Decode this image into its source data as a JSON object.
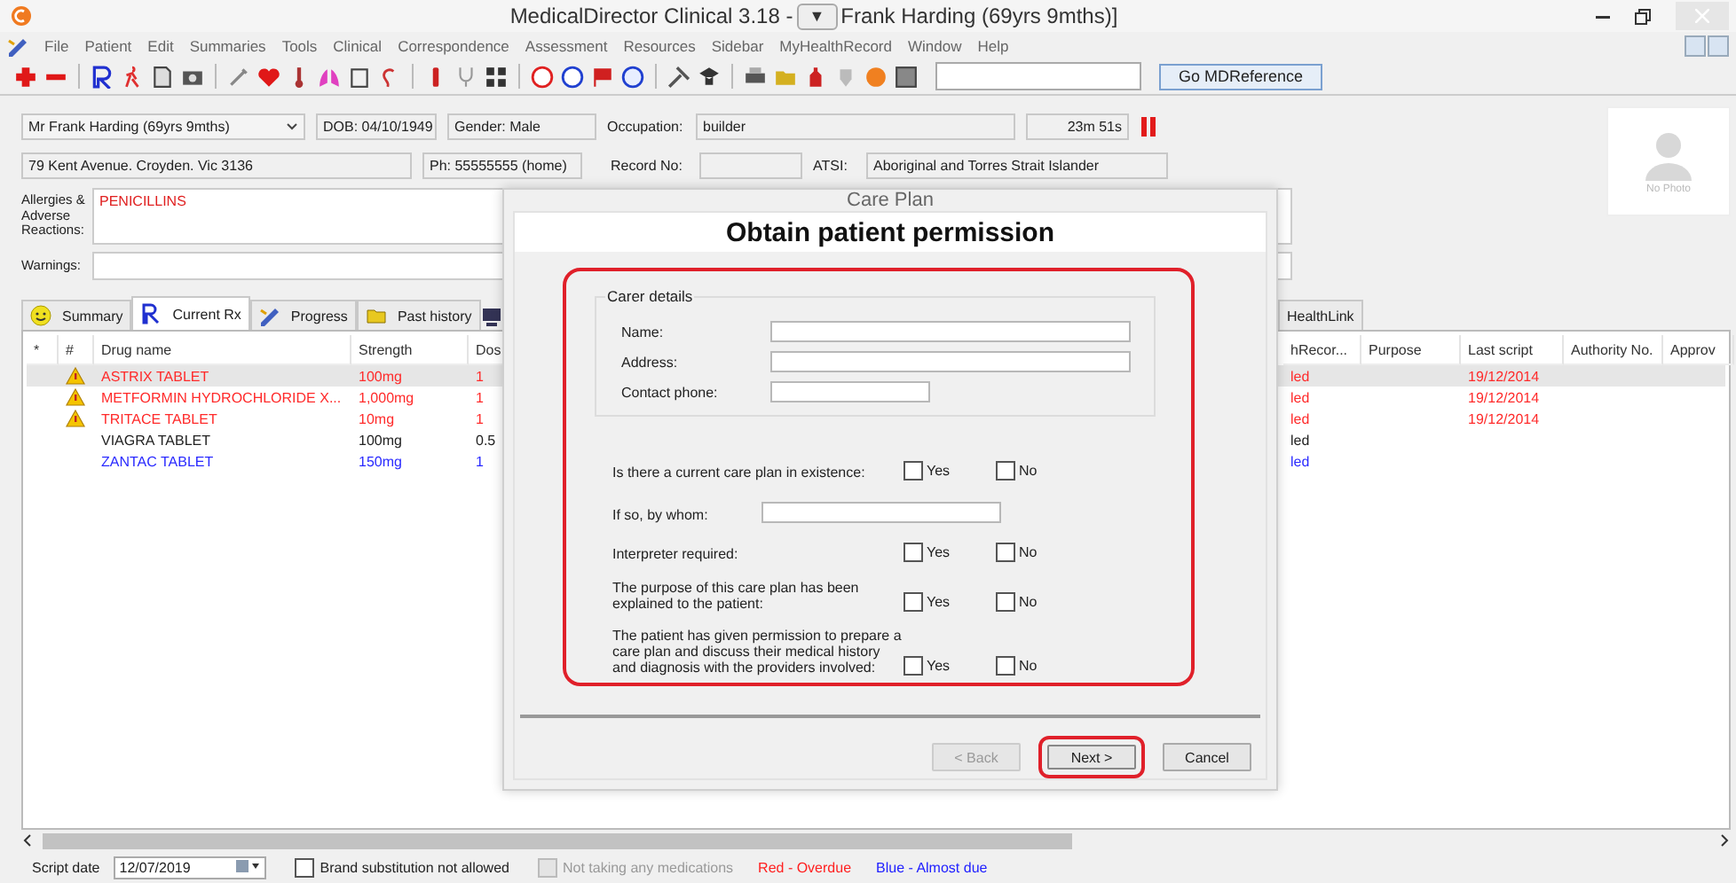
{
  "window": {
    "title_app": "MedicalDirector Clinical 3.18 -",
    "title_button": "▼",
    "title_patient": "Frank Harding (69yrs 9mths)]"
  },
  "menu": [
    "File",
    "Patient",
    "Edit",
    "Summaries",
    "Tools",
    "Clinical",
    "Correspondence",
    "Assessment",
    "Resources",
    "Sidebar",
    "MyHealthRecord",
    "Window",
    "Help"
  ],
  "toolbar": {
    "search_button": "Go MDReference"
  },
  "patient": {
    "name": "Mr Frank Harding (69yrs 9mths)",
    "dob": "DOB: 04/10/1949",
    "gender": "Gender: Male",
    "occupation_label": "Occupation:",
    "occupation": "builder",
    "timer": "23m 51s",
    "timer_paused": false,
    "address": "79 Kent Avenue. Croyden. Vic  3136",
    "phone": "Ph: 55555555 (home)",
    "record_label": "Record No:",
    "atsi_label": "ATSI:",
    "atsi": "Aboriginal and Torres Strait Islander",
    "photo": "No Photo",
    "allergies_label": "Allergies & Adverse Reactions:",
    "allergies": "PENICILLINS",
    "warnings_label": "Warnings:"
  },
  "tabs": [
    {
      "label": "Summary",
      "selected": false
    },
    {
      "label": "Current Rx",
      "selected": true
    },
    {
      "label": "Progress",
      "selected": false
    },
    {
      "label": "Past history",
      "selected": false
    },
    {
      "label": "HealthLink",
      "selected": false
    }
  ],
  "table": {
    "columns": [
      "*",
      "#",
      "Drug name",
      "Strength",
      "Dos",
      "hRecor...",
      "Purpose",
      "Last script",
      "Authority No.",
      "Approv"
    ],
    "rows": [
      {
        "warning": true,
        "color": "#ff2a2a",
        "selected": true,
        "drug": "ASTRIX TABLET",
        "strength": "100mg",
        "dose": "1",
        "column_6": "led",
        "last_script": "19/12/2014"
      },
      {
        "warning": true,
        "color": "#ff2a2a",
        "selected": false,
        "drug": "METFORMIN HYDROCHLORIDE X...",
        "strength": "1,000mg",
        "dose": "1",
        "column_6": "led",
        "last_script": "19/12/2014"
      },
      {
        "warning": true,
        "color": "#ff2a2a",
        "selected": false,
        "drug": "TRITACE TABLET",
        "strength": "10mg",
        "dose": "1",
        "column_6": "led",
        "last_script": "19/12/2014"
      },
      {
        "warning": false,
        "color": "#222222",
        "selected": false,
        "drug": "VIAGRA TABLET",
        "strength": "100mg",
        "dose": "0.5",
        "column_6": "led"
      },
      {
        "warning": false,
        "color": "#2a2aff",
        "selected": false,
        "drug": "ZANTAC TABLET",
        "strength": "150mg",
        "dose": "1",
        "column_6": "led"
      }
    ]
  },
  "dialog": {
    "title": "Care Plan",
    "heading": "Obtain patient permission",
    "group_label": "Carer details",
    "carer_fields": [
      {
        "label": "Name:"
      },
      {
        "label": "Address:"
      },
      {
        "label": "Contact phone:"
      }
    ],
    "questions": [
      {
        "kind": "yesno",
        "label": "Is there a current care plan in existence:",
        "yes": {
          "label": "Yes",
          "checked": false
        },
        "no": {
          "label": "No",
          "checked": false
        }
      },
      {
        "kind": "text",
        "label": "If so, by whom:"
      },
      {
        "kind": "yesno",
        "label": "Interpreter required:",
        "yes": {
          "label": "Yes",
          "checked": false
        },
        "no": {
          "label": "No",
          "checked": false
        }
      },
      {
        "kind": "yesno",
        "label": "The purpose of this care plan has been explained to the patient:",
        "yes": {
          "label": "Yes",
          "checked": false
        },
        "no": {
          "label": "No",
          "checked": false
        }
      },
      {
        "kind": "yesno",
        "label": "The patient has given permission to prepare a care plan and discuss their medical history and diagnosis with the providers involved:",
        "yes": {
          "label": "Yes",
          "checked": false
        },
        "no": {
          "label": "No",
          "checked": false
        }
      }
    ],
    "buttons": [
      {
        "label": "< Back",
        "disabled": true,
        "highlighted": false
      },
      {
        "label": "Next >",
        "disabled": false,
        "highlighted": true
      },
      {
        "label": "Cancel",
        "disabled": false,
        "highlighted": false
      }
    ]
  },
  "status_bar": {
    "script_date_label": "Script date",
    "script_date": "12/07/2019",
    "options": [
      {
        "label": "Brand substitution not allowed",
        "checked": false,
        "disabled": false
      },
      {
        "label": "Not taking any medications",
        "checked": false,
        "disabled": true
      }
    ],
    "legend": [
      {
        "label": "Red - Overdue",
        "color": "#ff2020"
      },
      {
        "label": "Blue - Almost due",
        "color": "#2020ff"
      }
    ]
  }
}
